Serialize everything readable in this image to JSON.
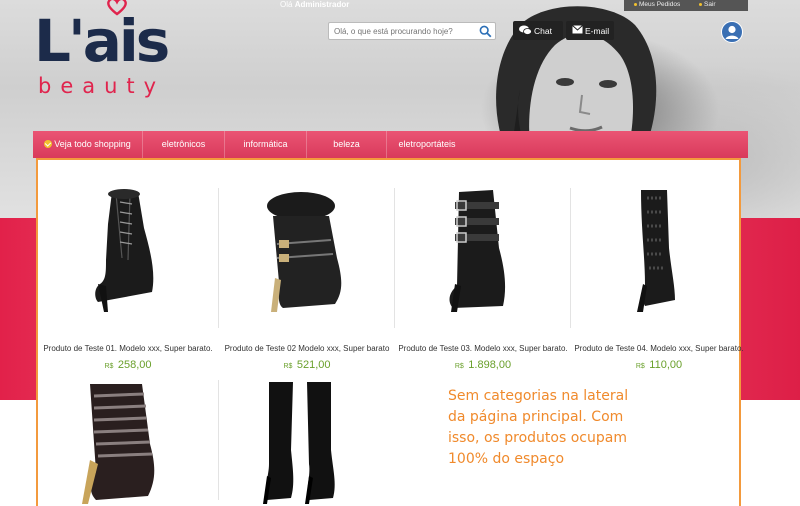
{
  "brand": {
    "logo_main": "L'ais",
    "logo_sub": "beauty"
  },
  "header": {
    "greeting_prefix": "Olá",
    "greeting_user": "Administrador",
    "search_placeholder": "Olá, o que está procurando hoje?",
    "chat_label": "Chat",
    "email_label": "E-mail",
    "top_links": [
      "Meus Pedidos",
      "Sair"
    ]
  },
  "nav": {
    "items": [
      "Veja todo shopping",
      "eletrônicos",
      "informática",
      "beleza",
      "eletroportáteis"
    ]
  },
  "products": [
    {
      "name": "Produto de Teste 01. Modelo xxx, Super barato.",
      "currency": "R$",
      "price": "258,00"
    },
    {
      "name": "Produto de Teste 02 Modelo xxx, Super barato",
      "currency": "R$",
      "price": "521,00"
    },
    {
      "name": "Produto de Teste 03. Modelo xxx, Super barato.",
      "currency": "R$",
      "price": "1.898,00"
    },
    {
      "name": "Produto de Teste 04. Modelo xxx, Super barato.",
      "currency": "R$",
      "price": "110,00"
    }
  ],
  "annotation": {
    "lines": [
      "Sem categorias na lateral",
      "da página principal. Com",
      "isso, os produtos ocupam",
      "100% do espaço"
    ]
  },
  "colors": {
    "brand_navy": "#1c2b4a",
    "brand_pink": "#e0244d",
    "nav_pink": "#e04a69",
    "price_green": "#6aa02b",
    "annotation_orange": "#f08a2c"
  }
}
